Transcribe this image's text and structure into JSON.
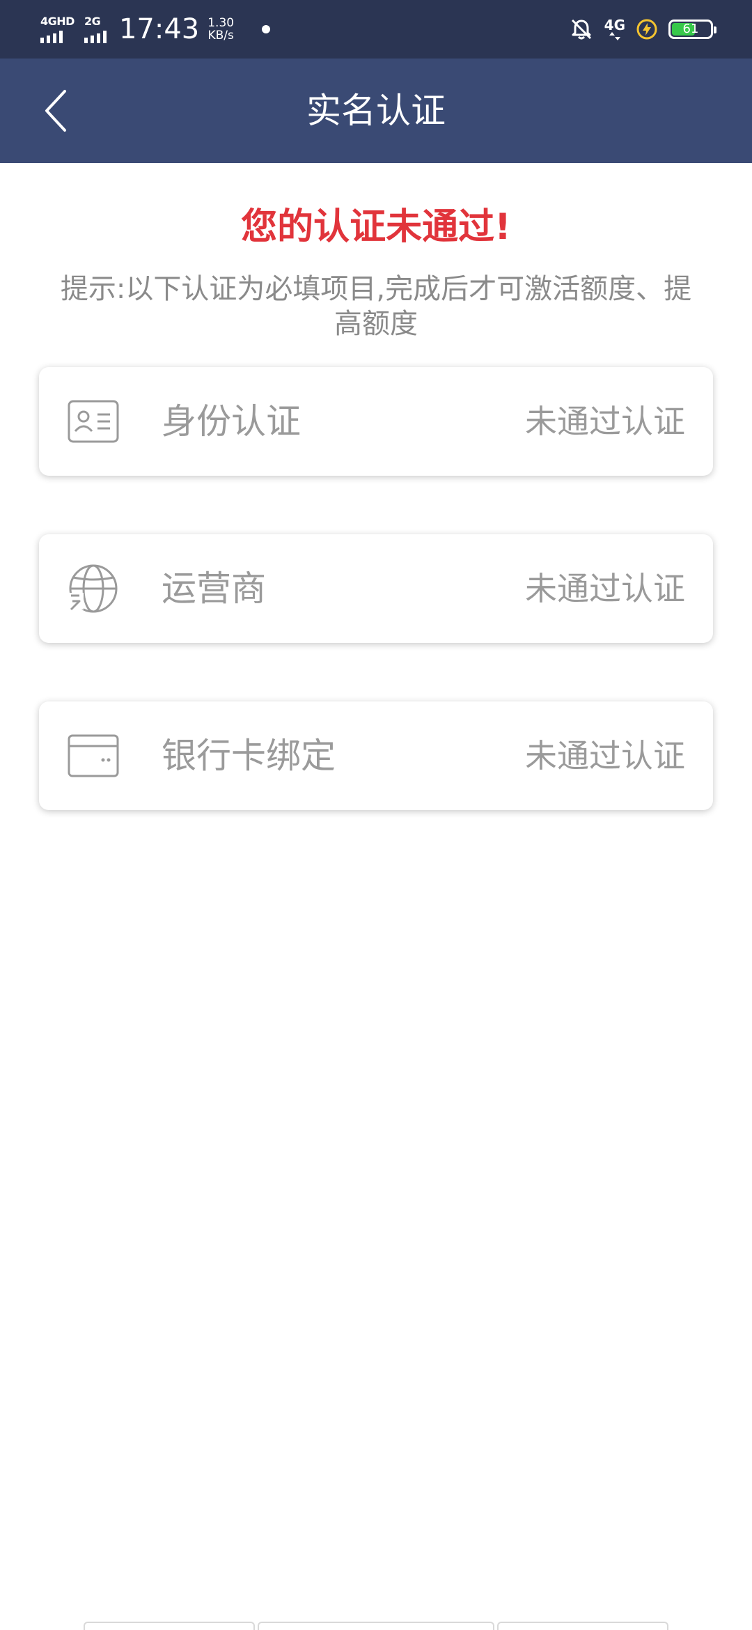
{
  "status_bar": {
    "network_left_1": "4GHD",
    "network_left_2": "2G",
    "time": "17:43",
    "speed_value": "1.30",
    "speed_unit": "KB/s",
    "network_right": "4G",
    "battery_level": "61",
    "battery_fraction": 0.61,
    "battery_color": "#37c84a"
  },
  "app_bar": {
    "title": "实名认证",
    "back_icon": "chevron-left-icon"
  },
  "alert": {
    "title": "您的认证未通过!",
    "tip": "提示:以下认证为必填项目,完成后才可激活额度、提高额度",
    "title_color": "#e1343b"
  },
  "verification_items": [
    {
      "icon": "id-card-icon",
      "label": "身份认证",
      "status": "未通过认证"
    },
    {
      "icon": "carrier-globe-icon",
      "label": "运营商",
      "status": "未通过认证"
    },
    {
      "icon": "bank-card-icon",
      "label": "银行卡绑定",
      "status": "未通过认证"
    }
  ]
}
